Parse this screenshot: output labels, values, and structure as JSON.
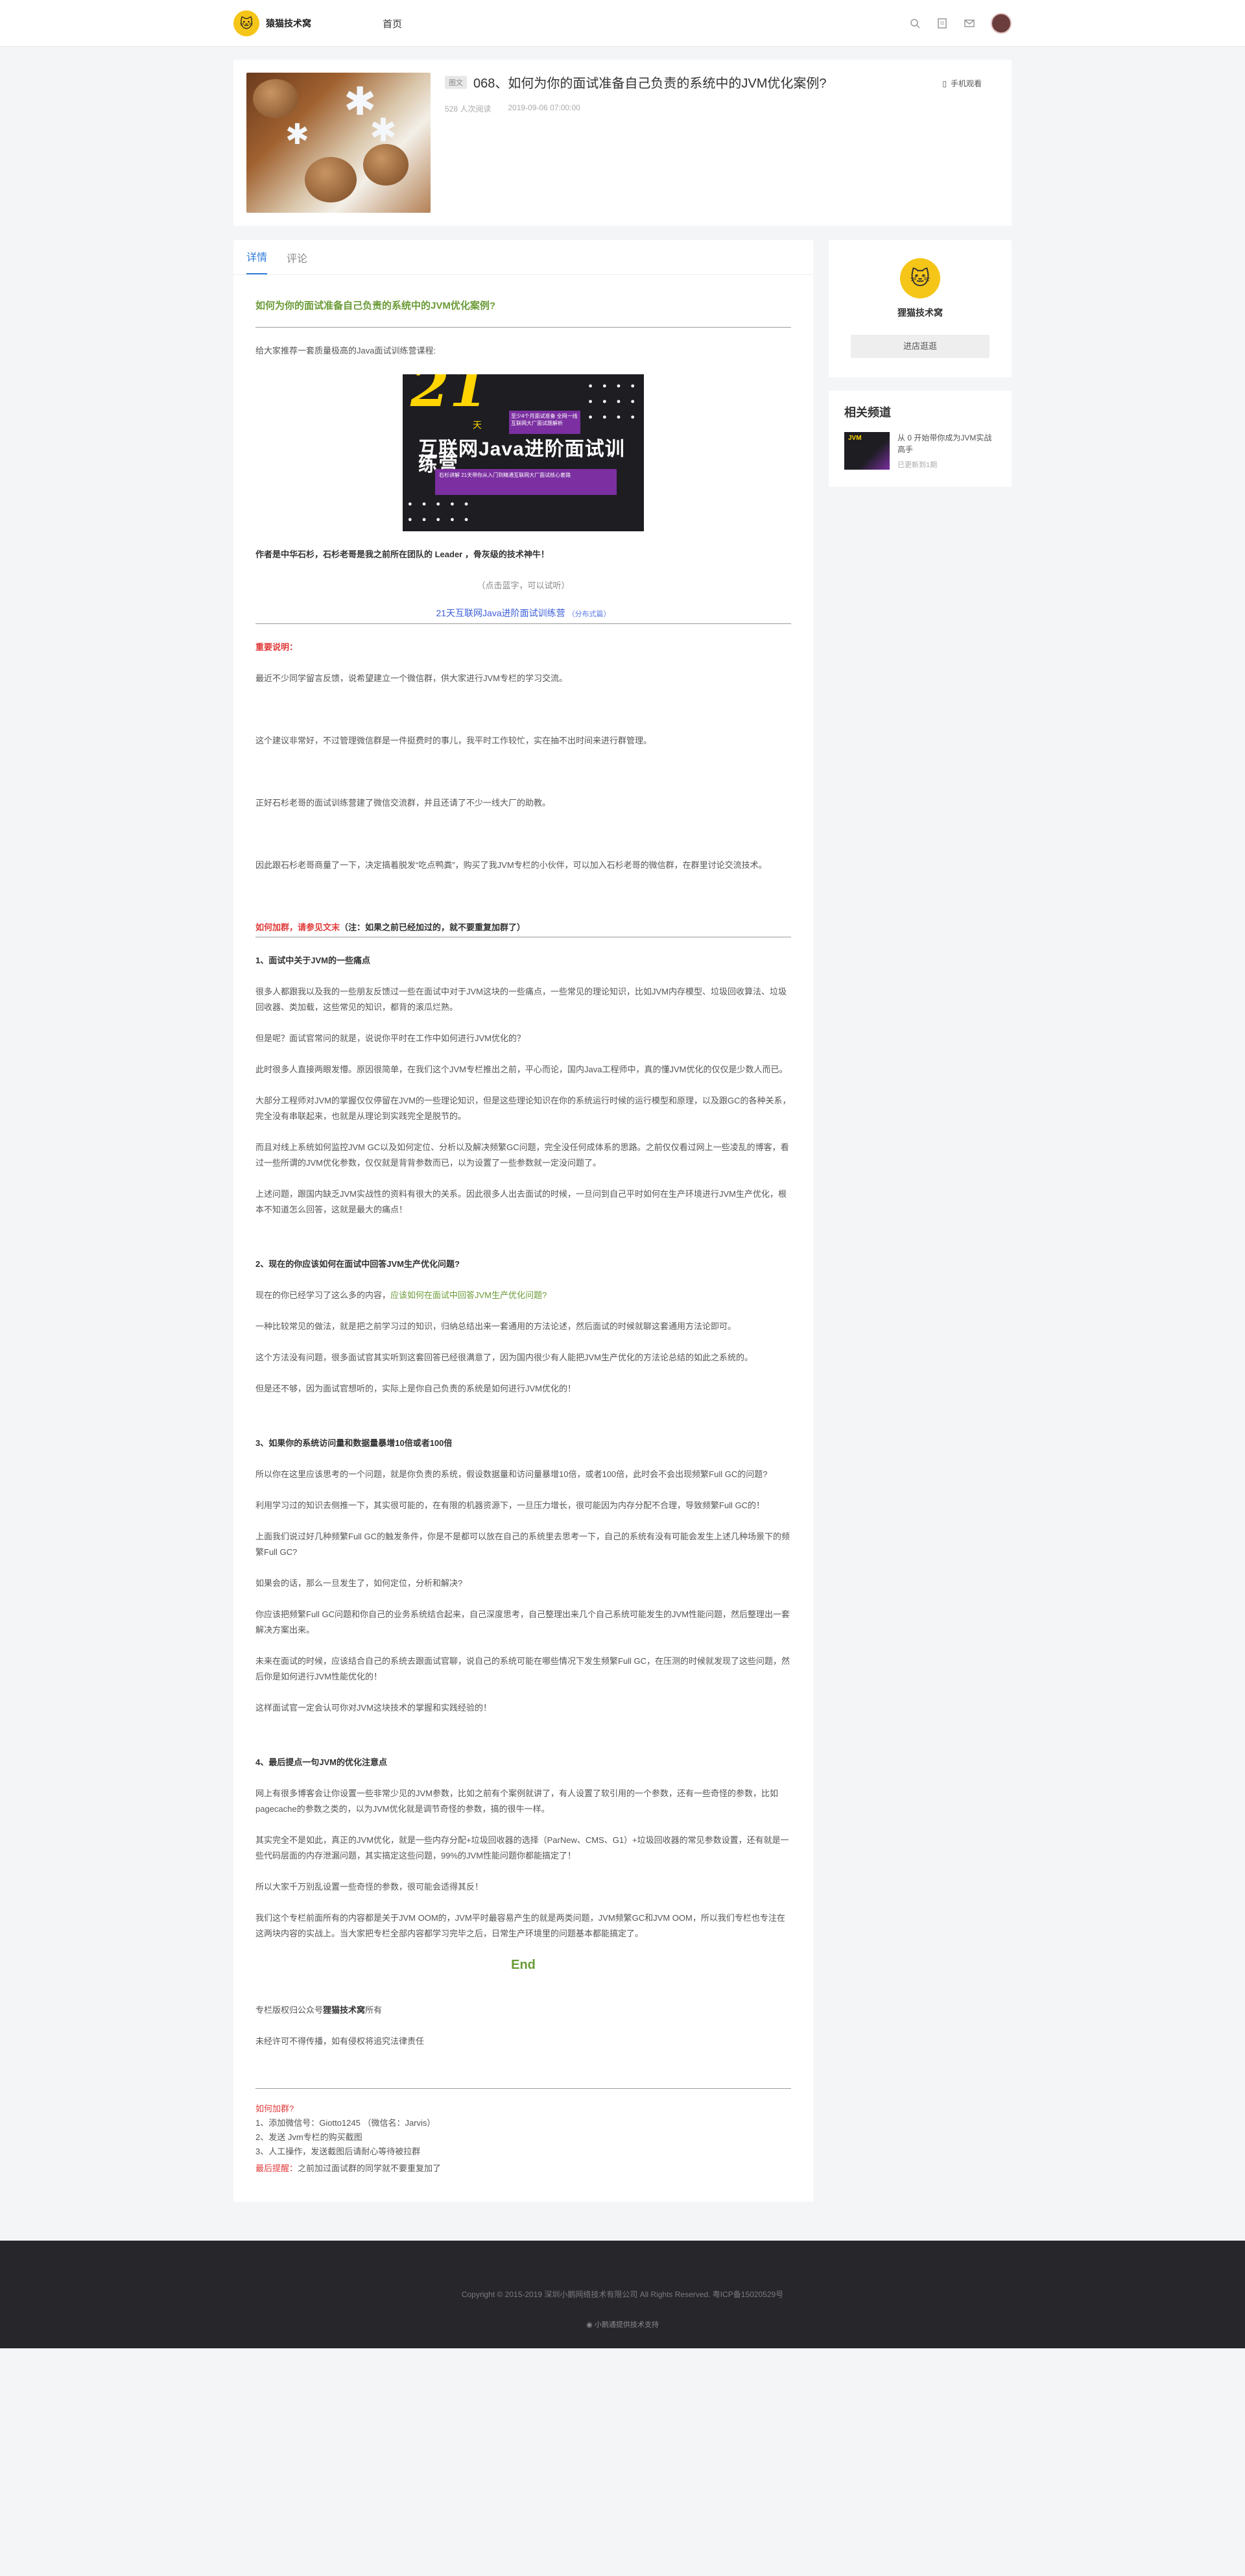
{
  "header": {
    "brand": "猿猫技术窝",
    "logo_glyph": "🐱",
    "nav_home": "首页",
    "icons": [
      "search-icon",
      "document-icon",
      "mail-icon"
    ]
  },
  "post": {
    "tag": "图文",
    "title": "068、如何为你的面试准备自己负责的系统中的JVM优化案例?",
    "reads": "528 人次阅读",
    "date": "2019-09-06 07:00:00",
    "mobile_view": "手机观看"
  },
  "tabs": [
    "详情",
    "评论"
  ],
  "article": {
    "h1": "如何为你的面试准备自己负责的系统中的JVM优化案例?",
    "intro": "给大家推荐一套质量极高的Java面试训练营课程:",
    "banner": {
      "big": "21",
      "tian": "天",
      "title": "互联网Java进阶面试训练营",
      "box1": "至少4个月面试准备  全网一线互联网大厂面试题解析",
      "box2": "石杉讲解  21天带你从入门到精通互联网大厂面试核心套路"
    },
    "author": "作者是中华石杉，石杉老哥是我之前所在团队的 Leader ，骨灰级的技术神牛！",
    "click": "（点击蓝字，可以试听）",
    "course": "21天互联网Java进阶面试训练营",
    "course_note": "（分布式篇）",
    "important": "重要说明：",
    "p1": "最近不少同学留言反馈，说希望建立一个微信群，供大家进行JVM专栏的学习交流。",
    "p2": "这个建议非常好，不过管理微信群是一件挺费时的事儿，我平时工作较忙，实在抽不出时间来进行群管理。",
    "p3": "正好石杉老哥的面试训练营建了微信交流群，并且还请了不少一线大厂的助教。",
    "p4": "因此跟石杉老哥商量了一下，决定搞着脱发“吃点鸭粪”，购买了我JVM专栏的小伙伴，可以加入石杉老哥的微信群，在群里讨论交流技术。",
    "join_red": "如何加群，请参见文末",
    "join_black": "（注：如果之前已经加过的，就不要重复加群了）",
    "s1": "1、面试中关于JVM的一些痛点",
    "s1p1": "很多人都跟我以及我的一些朋友反馈过一些在面试中对于JVM这块的一些痛点，一些常见的理论知识，比如JVM内存模型、垃圾回收算法、垃圾回收器、类加载，这些常见的知识，都背的滚瓜烂熟。",
    "s1p2": "但是呢？面试官常问的就是，说说你平时在工作中如何进行JVM优化的？",
    "s1p3": "此时很多人直接两眼发懵。原因很简单，在我们这个JVM专栏推出之前，平心而论，国内Java工程师中，真的懂JVM优化的仅仅是少数人而已。",
    "s1p4": "大部分工程师对JVM的掌握仅仅停留在JVM的一些理论知识，但是这些理论知识在你的系统运行时候的运行模型和原理，以及跟GC的各种关系，完全没有串联起来，也就是从理论到实践完全是脱节的。",
    "s1p5": "而且对线上系统如何监控JVM GC以及如何定位、分析以及解决频繁GC问题，完全没任何成体系的思路。之前仅仅看过网上一些凌乱的博客，看过一些所谓的JVM优化参数，仅仅就是背背参数而已，以为设置了一些参数就一定没问题了。",
    "s1p6": "上述问题，跟国内缺乏JVM实战性的资料有很大的关系。因此很多人出去面试的时候，一旦问到自己平时如何在生产环境进行JVM生产优化，根本不知道怎么回答，这就是最大的痛点！",
    "s2": "2、现在的你应该如何在面试中回答JVM生产优化问题?",
    "s2p1a": "现在的你已经学习了这么多的内容，",
    "s2p1b": "应该如何在面试中回答JVM生产优化问题?",
    "s2p2": "一种比较常见的做法，就是把之前学习过的知识，归纳总结出来一套通用的方法论述，然后面试的时候就聊这套通用方法论即可。",
    "s2p3": "这个方法没有问题，很多面试官其实听到这套回答已经很满意了，因为国内很少有人能把JVM生产优化的方法论总结的如此之系统的。",
    "s2p4": "但是还不够，因为面试官想听的，实际上是你自己负责的系统是如何进行JVM优化的！",
    "s3": "3、如果你的系统访问量和数据量暴增10倍或者100倍",
    "s3p1": "所以你在这里应该思考的一个问题，就是你负责的系统，假设数据量和访问量暴增10倍，或者100倍，此时会不会出现频繁Full GC的问题?",
    "s3p2": "利用学习过的知识去侧推一下，其实很可能的，在有限的机器资源下，一旦压力增长，很可能因为内存分配不合理，导致频繁Full GC的！",
    "s3p3": "上面我们说过好几种频繁Full GC的触发条件，你是不是都可以放在自己的系统里去思考一下，自己的系统有没有可能会发生上述几种场景下的频繁Full GC?",
    "s3p4": "如果会的话，那么一旦发生了，如何定位，分析和解决?",
    "s3p5": "你应该把频繁Full GC问题和你自己的业务系统结合起来，自己深度思考，自己整理出来几个自己系统可能发生的JVM性能问题，然后整理出一套解决方案出来。",
    "s3p6": "未来在面试的时候，应该结合自己的系统去跟面试官聊，说自己的系统可能在哪些情况下发生频繁Full GC，在压测的时候就发现了这些问题，然后你是如何进行JVM性能优化的！",
    "s3p7": "这样面试官一定会认可你对JVM这块技术的掌握和实践经验的！",
    "s4": "4、最后提点一句JVM的优化注意点",
    "s4p1": "网上有很多博客会让你设置一些非常少见的JVM参数，比如之前有个案例就讲了，有人设置了软引用的一个参数，还有一些奇怪的参数，比如pagecache的参数之类的，以为JVM优化就是调节奇怪的参数，搞的很牛一样。",
    "s4p2": "其实完全不是如此，真正的JVM优化，就是一些内存分配+垃圾回收器的选择（ParNew、CMS、G1）+垃圾回收器的常见参数设置，还有就是一些代码层面的内存泄漏问题，其实搞定这些问题，99%的JVM性能问题你都能搞定了！",
    "s4p3": "所以大家千万别乱设置一些奇怪的参数，很可能会适得其反！",
    "s4p4": "我们这个专栏前面所有的内容都是关于JVM OOM的，JVM平时最容易产生的就是两类问题，JVM频繁GC和JVM OOM，所以我们专栏也专注在这两块内容的实战上。当大家把专栏全部内容都学习完毕之后，日常生产环境里的问题基本都能搞定了。",
    "end": "End",
    "copy1a": "专栏版权归公众号",
    "copy1b": "狸猫技术窝",
    "copy1c": "所有",
    "copy2": "未经许可不得传播，如有侵权将追究法律责任",
    "join_title": "如何加群?",
    "join1": "1、添加微信号：Giotto1245 （微信名：Jarvis）",
    "join2": "2、发送 Jvm专栏的购买截图",
    "join3": "3、人工操作，发送截图后请耐心等待被拉群",
    "join_red_label": "最后提醒：",
    "join_red_text": "之前加过面试群的同学就不要重复加了"
  },
  "sidebar": {
    "name": "狸猫技术窝",
    "enter": "进店逛逛",
    "related_title": "相关频道",
    "related_text": "从 0 开始带你成为JVM实战高手",
    "related_sub": "已更新到1期"
  },
  "footer": {
    "copyright": "Copyright © 2015-2019 深圳小鹅网络技术有限公司 All Rights Reserved. 粤ICP备15020529号",
    "powered": "小鹅通提供技术支持"
  }
}
